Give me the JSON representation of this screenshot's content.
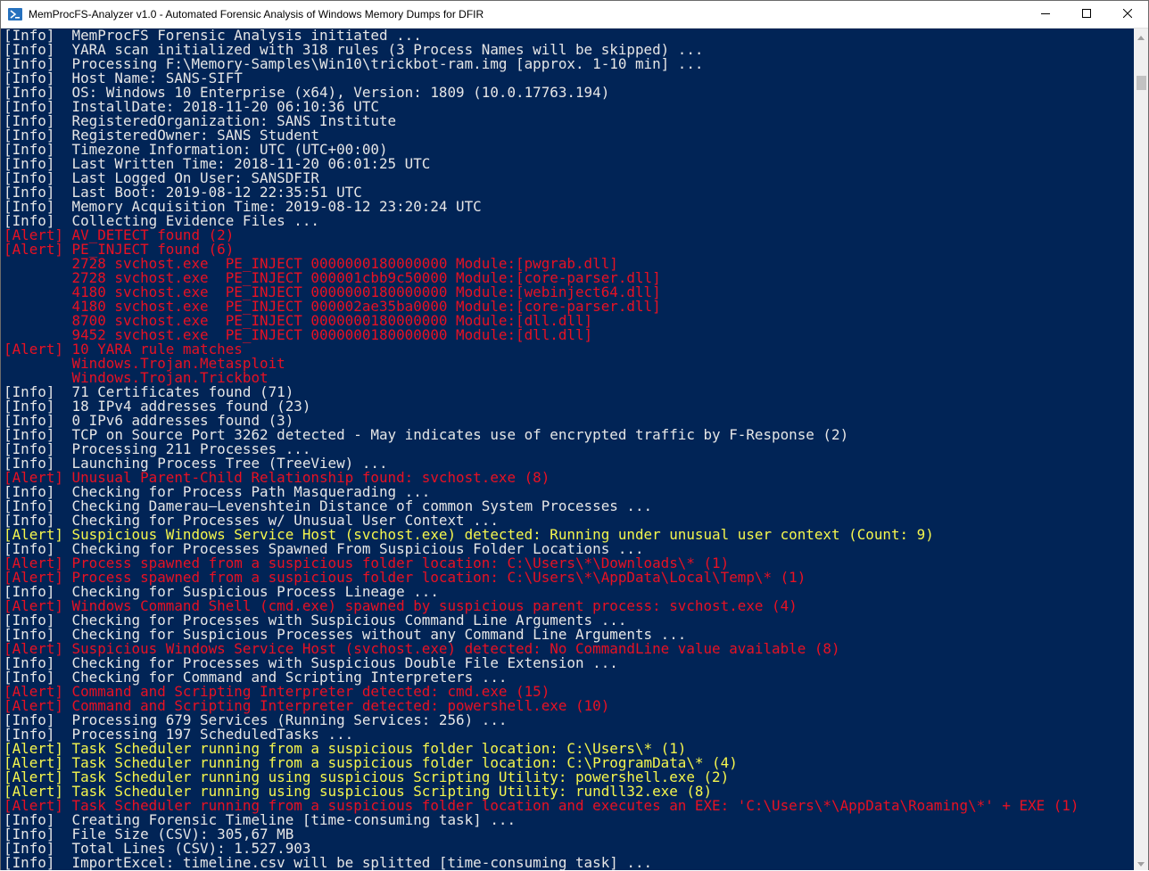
{
  "window": {
    "title": "MemProcFS-Analyzer v1.0 - Automated Forensic Analysis of Windows Memory Dumps for DFIR",
    "icon": "powershell-icon",
    "controls": [
      "minimize-icon",
      "maximize-icon",
      "close-icon"
    ]
  },
  "colors": {
    "console_bg": "#012456",
    "info": "#e6e6e6",
    "alert_red": "#e81123",
    "alert_yellow": "#f6f64d"
  },
  "console": {
    "lines": [
      {
        "text": "[Info]  MemProcFS Forensic Analysis initiated ...",
        "style": "info"
      },
      {
        "text": "[Info]  YARA scan initialized with 318 rules (3 Process Names will be skipped) ...",
        "style": "info"
      },
      {
        "text": "[Info]  Processing F:\\Memory-Samples\\Win10\\trickbot-ram.img [approx. 1-10 min] ...",
        "style": "info"
      },
      {
        "text": "[Info]  Host Name: SANS-SIFT",
        "style": "info"
      },
      {
        "text": "[Info]  OS: Windows 10 Enterprise (x64), Version: 1809 (10.0.17763.194)",
        "style": "info"
      },
      {
        "text": "[Info]  InstallDate: 2018-11-20 06:10:36 UTC",
        "style": "info"
      },
      {
        "text": "[Info]  RegisteredOrganization: SANS Institute",
        "style": "info"
      },
      {
        "text": "[Info]  RegisteredOwner: SANS Student",
        "style": "info"
      },
      {
        "text": "[Info]  Timezone Information: UTC (UTC+00:00)",
        "style": "info"
      },
      {
        "text": "[Info]  Last Written Time: 2018-11-20 06:01:25 UTC",
        "style": "info"
      },
      {
        "text": "[Info]  Last Logged On User: SANSDFIR",
        "style": "info"
      },
      {
        "text": "[Info]  Last Boot: 2019-08-12 22:35:51 UTC",
        "style": "info"
      },
      {
        "text": "[Info]  Memory Acquisition Time: 2019-08-12 23:20:24 UTC",
        "style": "info"
      },
      {
        "text": "[Info]  Collecting Evidence Files ...",
        "style": "info"
      },
      {
        "text": "[Alert] AV_DETECT found (2)",
        "style": "red"
      },
      {
        "text": "[Alert] PE_INJECT found (6)",
        "style": "red"
      },
      {
        "text": "        2728 svchost.exe  PE_INJECT 0000000180000000 Module:[pwgrab.dll]",
        "style": "red"
      },
      {
        "text": "        2728 svchost.exe  PE_INJECT 000001cbb9c50000 Module:[core-parser.dll]",
        "style": "red"
      },
      {
        "text": "        4180 svchost.exe  PE_INJECT 0000000180000000 Module:[webinject64.dll]",
        "style": "red"
      },
      {
        "text": "        4180 svchost.exe  PE_INJECT 000002ae35ba0000 Module:[core-parser.dll]",
        "style": "red"
      },
      {
        "text": "        8700 svchost.exe  PE_INJECT 0000000180000000 Module:[dll.dll]",
        "style": "red"
      },
      {
        "text": "        9452 svchost.exe  PE_INJECT 0000000180000000 Module:[dll.dll]",
        "style": "red"
      },
      {
        "text": "[Alert] 10 YARA rule matches",
        "style": "red"
      },
      {
        "text": "        Windows.Trojan.Metasploit",
        "style": "red"
      },
      {
        "text": "        Windows.Trojan.Trickbot",
        "style": "red"
      },
      {
        "text": "[Info]  71 Certificates found (71)",
        "style": "info"
      },
      {
        "text": "[Info]  18 IPv4 addresses found (23)",
        "style": "info"
      },
      {
        "text": "[Info]  0 IPv6 addresses found (3)",
        "style": "info"
      },
      {
        "text": "[Info]  TCP on Source Port 3262 detected - May indicates use of encrypted traffic by F-Response (2)",
        "style": "info"
      },
      {
        "text": "[Info]  Processing 211 Processes ...",
        "style": "info"
      },
      {
        "text": "[Info]  Launching Process Tree (TreeView) ...",
        "style": "info"
      },
      {
        "text": "[Alert] Unusual Parent-Child Relationship found: svchost.exe (8)",
        "style": "red"
      },
      {
        "text": "[Info]  Checking for Process Path Masquerading ...",
        "style": "info"
      },
      {
        "text": "[Info]  Checking Damerau–Levenshtein Distance of common System Processes ...",
        "style": "info"
      },
      {
        "text": "[Info]  Checking for Processes w/ Unusual User Context ...",
        "style": "info"
      },
      {
        "text": "[Alert] Suspicious Windows Service Host (svchost.exe) detected: Running under unusual user context (Count: 9)",
        "style": "yellow"
      },
      {
        "text": "[Info]  Checking for Processes Spawned From Suspicious Folder Locations ...",
        "style": "info"
      },
      {
        "text": "[Alert] Process spawned from a suspicious folder location: C:\\Users\\*\\Downloads\\* (1)",
        "style": "red"
      },
      {
        "text": "[Alert] Process spawned from a suspicious folder location: C:\\Users\\*\\AppData\\Local\\Temp\\* (1)",
        "style": "red"
      },
      {
        "text": "[Info]  Checking for Suspicious Process Lineage ...",
        "style": "info"
      },
      {
        "text": "[Alert] Windows Command Shell (cmd.exe) spawned by suspicious parent process: svchost.exe (4)",
        "style": "red"
      },
      {
        "text": "[Info]  Checking for Processes with Suspicious Command Line Arguments ...",
        "style": "info"
      },
      {
        "text": "[Info]  Checking for Suspicious Processes without any Command Line Arguments ...",
        "style": "info"
      },
      {
        "text": "[Alert] Suspicious Windows Service Host (svchost.exe) detected: No CommandLine value available (8)",
        "style": "red"
      },
      {
        "text": "[Info]  Checking for Processes with Suspicious Double File Extension ...",
        "style": "info"
      },
      {
        "text": "[Info]  Checking for Command and Scripting Interpreters ...",
        "style": "info"
      },
      {
        "text": "[Alert] Command and Scripting Interpreter detected: cmd.exe (15)",
        "style": "red"
      },
      {
        "text": "[Alert] Command and Scripting Interpreter detected: powershell.exe (10)",
        "style": "red"
      },
      {
        "text": "[Info]  Processing 679 Services (Running Services: 256) ...",
        "style": "info"
      },
      {
        "text": "[Info]  Processing 197 ScheduledTasks ...",
        "style": "info"
      },
      {
        "text": "[Alert] Task Scheduler running from a suspicious folder location: C:\\Users\\* (1)",
        "style": "yellow"
      },
      {
        "text": "[Alert] Task Scheduler running from a suspicious folder location: C:\\ProgramData\\* (4)",
        "style": "yellow"
      },
      {
        "text": "[Alert] Task Scheduler running using suspicious Scripting Utility: powershell.exe (2)",
        "style": "yellow"
      },
      {
        "text": "[Alert] Task Scheduler running using suspicious Scripting Utility: rundll32.exe (8)",
        "style": "yellow"
      },
      {
        "text": "[Alert] Task Scheduler running from a suspicious folder location and executes an EXE: 'C:\\Users\\*\\AppData\\Roaming\\*' + EXE (1)",
        "style": "red"
      },
      {
        "text": "[Info]  Creating Forensic Timeline [time-consuming task] ...",
        "style": "info"
      },
      {
        "text": "[Info]  File Size (CSV): 305,67 MB",
        "style": "info"
      },
      {
        "text": "[Info]  Total Lines (CSV): 1.527.903",
        "style": "info"
      },
      {
        "text": "[Info]  ImportExcel: timeline.csv will be splitted [time-consuming task] ...",
        "style": "info"
      }
    ]
  },
  "scrollbar": {
    "icons": [
      "scroll-up-icon",
      "scroll-down-icon"
    ],
    "position_fraction": 0.04
  }
}
